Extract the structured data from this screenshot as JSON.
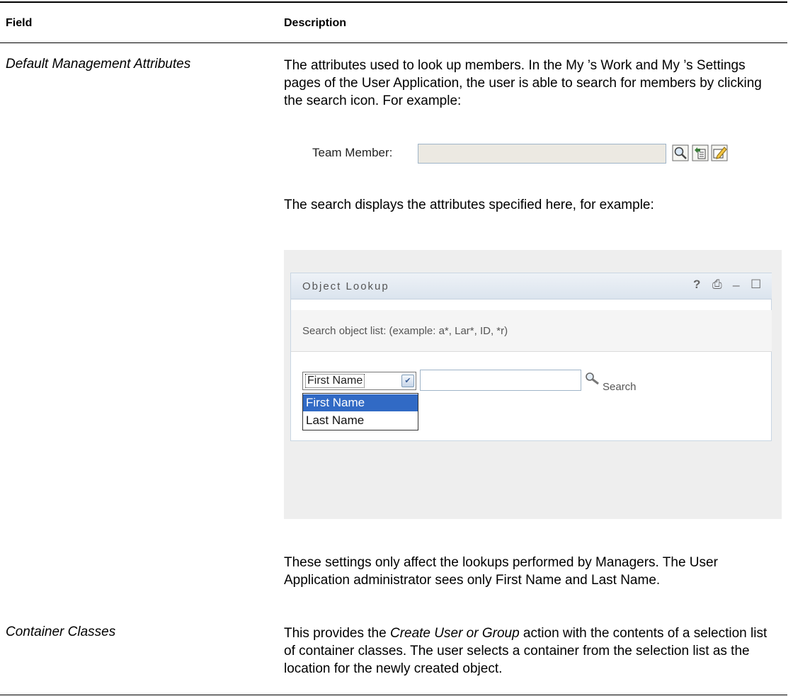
{
  "table": {
    "header": {
      "field": "Field",
      "description": "Description"
    },
    "rows": [
      {
        "field": "Default  Management Attributes",
        "paragraphs": {
          "p1": "The attributes used to look up  members. In the My ’s Work and My ’s Settings pages of the User Application, the user is able to search for  members by clicking the search icon. For example:",
          "p2": "The search displays the attributes specified here, for example:",
          "p3": "These settings only affect the lookups performed by  Managers. The User Application administrator sees only First Name and Last Name."
        },
        "team_member_figure": {
          "label": "Team Member:",
          "icons": [
            "search-icon",
            "history-icon",
            "reset-icon"
          ]
        },
        "object_lookup_figure": {
          "title": "Object Lookup",
          "controls": {
            "help": "?",
            "print": "⎙",
            "minimize": "_",
            "maximize": "☐"
          },
          "hint": "Search object list: (example: a*, Lar*, ID, *r)",
          "selected_attribute": "First Name",
          "options": [
            "First Name",
            "Last Name"
          ],
          "search_label": "Search"
        }
      },
      {
        "field": "Container Classes",
        "paragraph_pre": "This provides the ",
        "paragraph_em": "Create User or Group",
        "paragraph_post": " action with the contents of a selection list of container classes. The user selects a container from the selection list as the location for the newly created object."
      }
    ]
  }
}
